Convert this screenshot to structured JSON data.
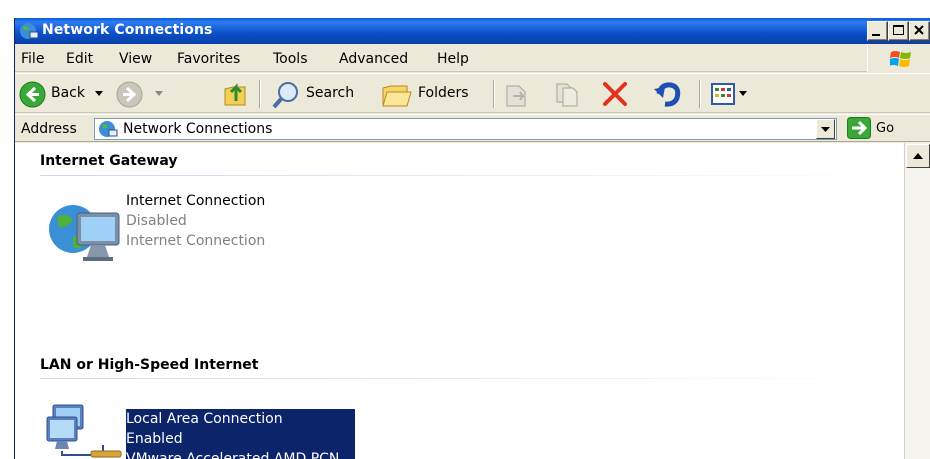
{
  "window": {
    "title": "Network Connections"
  },
  "menu": [
    "File",
    "Edit",
    "View",
    "Favorites",
    "Tools",
    "Advanced",
    "Help"
  ],
  "toolbar": {
    "back_label": "Back",
    "search_label": "Search",
    "folders_label": "Folders"
  },
  "address": {
    "label": "Address",
    "value": "Network Connections",
    "go_label": "Go"
  },
  "groups": [
    {
      "header": "Internet Gateway",
      "items": [
        {
          "name": "Internet Connection",
          "status": "Disabled",
          "device": "Internet Connection"
        }
      ]
    },
    {
      "header": "LAN or High-Speed Internet",
      "items": [
        {
          "name": "Local Area Connection",
          "status": "Enabled",
          "device": "VMware Accelerated AMD PCN..."
        }
      ]
    }
  ],
  "colors": {
    "titlebar": "#0b4fc8",
    "selection": "#0b246a",
    "window_bg": "#ece9d8"
  },
  "icons": [
    "network-connections-icon",
    "windows-logo-icon",
    "back-arrow-icon",
    "forward-arrow-icon",
    "up-folder-icon",
    "search-magnifier-icon",
    "folders-icon",
    "move-to-icon",
    "copy-to-icon",
    "delete-icon",
    "undo-icon",
    "views-icon",
    "go-arrow-icon",
    "internet-connection-icon",
    "lan-connection-icon"
  ]
}
